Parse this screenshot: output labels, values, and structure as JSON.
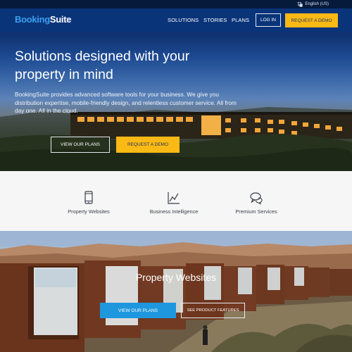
{
  "topbar": {
    "language": "English (US)",
    "language_icon": "translate-icon"
  },
  "header": {
    "logo_part1": "Booking",
    "logo_part2": "Suite",
    "nav": [
      "SOLUTIONS",
      "STORIES",
      "PLANS"
    ],
    "login_label": "LOG IN",
    "request_demo_label": "REQUEST A DEMO"
  },
  "hero": {
    "title": "Solutions designed with your property in mind",
    "text": "BookingSuite provides advanced software tools for your business. We give you distribution expertise, mobile-friendly design, and relentless customer service. All from day one. All in the cloud.",
    "view_plans_label": "VIEW OUR PLANS",
    "request_demo_label": "REQUEST A DEMO"
  },
  "features": [
    {
      "label": "Property Websites",
      "icon": "mobile-phone-icon"
    },
    {
      "label": "Business Intelligence",
      "icon": "line-chart-icon"
    },
    {
      "label": "Premium Services",
      "icon": "chat-bubbles-icon"
    }
  ],
  "section2": {
    "title": "Property Websites",
    "view_plans_label": "VIEW OUR PLANS",
    "see_features_label": "SEE PRODUCT FEATURES"
  },
  "colors": {
    "topbar": "#061a3b",
    "header": "#0a3479",
    "logo_accent": "#3ba0f0",
    "cta_yellow": "#fbb915",
    "cta_blue": "#1e97de"
  }
}
